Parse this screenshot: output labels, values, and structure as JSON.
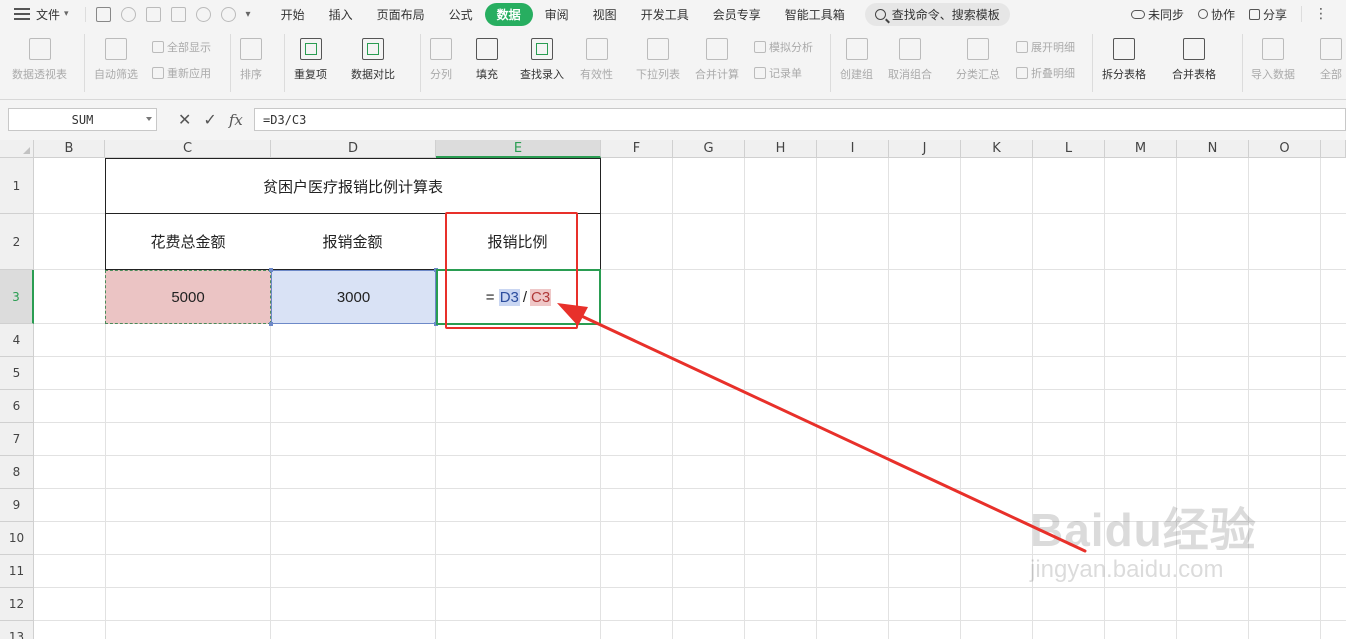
{
  "menu": {
    "file_label": "文件",
    "tabs": [
      "开始",
      "插入",
      "页面布局",
      "公式",
      "数据",
      "审阅",
      "视图",
      "开发工具",
      "会员专享",
      "智能工具箱"
    ],
    "active_tab": "数据",
    "search_label": "查找命令、搜索模板",
    "sync_label": "未同步",
    "collab_label": "协作",
    "share_label": "分享"
  },
  "ribbon": {
    "pivot": "数据透视表",
    "autofilter": "自动筛选",
    "show_all": "全部显示",
    "reapply": "重新应用",
    "sort": "排序",
    "duplicates": "重复项",
    "compare": "数据对比",
    "split_col": "分列",
    "fill": "填充",
    "find_enter": "查找录入",
    "validity": "有效性",
    "dropdown": "下拉列表",
    "consolidate": "合并计算",
    "simulate": "模拟分析",
    "record": "记录单",
    "create_group": "创建组",
    "ungroup": "取消组合",
    "subtotal": "分类汇总",
    "expand": "展开明细",
    "collapse": "折叠明细",
    "split_table": "拆分表格",
    "merge_table": "合并表格",
    "import": "导入数据",
    "all": "全部"
  },
  "formula_bar": {
    "name_box": "SUM",
    "cancel_glyph": "✕",
    "confirm_glyph": "✓",
    "fx_label": "fx",
    "formula": "=D3/C3"
  },
  "sheet": {
    "columns": [
      "B",
      "C",
      "D",
      "E",
      "F",
      "G",
      "H",
      "I",
      "J",
      "K",
      "L",
      "M",
      "N",
      "O"
    ],
    "rows": [
      "1",
      "2",
      "3",
      "4",
      "5",
      "6",
      "7",
      "8",
      "9",
      "10",
      "11",
      "12",
      "13"
    ],
    "title": "贫困户医疗报销比例计算表",
    "headers": [
      "花费总金额",
      "报销金额",
      "报销比例"
    ],
    "values": {
      "c3": "5000",
      "d3": "3000",
      "e3_eq": "= ",
      "e3_ref1": "D3",
      "e3_div": "/",
      "e3_ref2": "C3"
    }
  },
  "watermark": {
    "brand": "Baidu经验",
    "url": "jingyan.baidu.com"
  },
  "colors": {
    "accent": "#27ae60",
    "highlight_box": "#e8302a",
    "c3_fill": "#ebc4c4",
    "d3_fill": "#d9e2f5"
  }
}
